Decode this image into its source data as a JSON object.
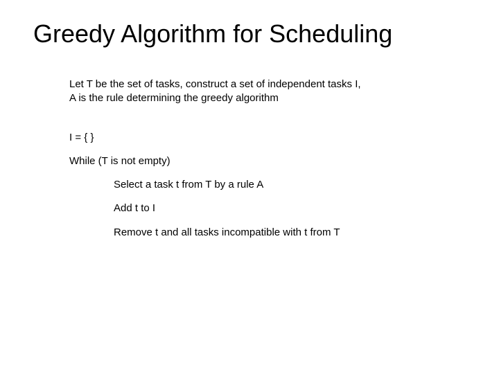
{
  "title": "Greedy Algorithm for Scheduling",
  "intro": {
    "line1": "Let T be the set of tasks, construct a set of independent tasks I,",
    "line2": "A is the rule determining the greedy algorithm"
  },
  "steps": {
    "init": "I = { }",
    "while": "While (T is not empty)",
    "select": "Select a task t from T by a rule A",
    "add": "Add t to I",
    "remove": "Remove t and all tasks incompatible with t from T"
  }
}
